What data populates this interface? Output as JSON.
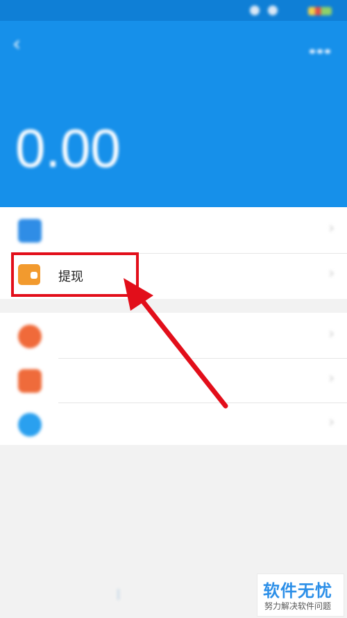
{
  "status_bar": {
    "carrier": "",
    "time": "",
    "battery": ""
  },
  "header": {
    "title": "",
    "balance_label": "",
    "balance": "0.00"
  },
  "list_primary": [
    {
      "label": "",
      "value": ""
    },
    {
      "label": "提现",
      "value": ""
    }
  ],
  "list_secondary": [
    {
      "label": "",
      "value": ""
    },
    {
      "label": "",
      "value": ""
    },
    {
      "label": "",
      "value": ""
    }
  ],
  "footer": {
    "link_left": "",
    "separator": "|",
    "link_right": ""
  },
  "watermark": {
    "title": "软件无忧",
    "subtitle": "努力解决软件问题"
  },
  "colors": {
    "header_blue": "#1690ea",
    "highlight_red": "#e20e1a",
    "withdraw_icon_orange": "#f29a2e"
  },
  "icons": [
    "back-arrow-icon",
    "more-dots-icon",
    "recharge-icon",
    "wallet-icon",
    "yuebao-icon",
    "fund-icon",
    "yuelibao-icon",
    "chevron-right-icon"
  ]
}
